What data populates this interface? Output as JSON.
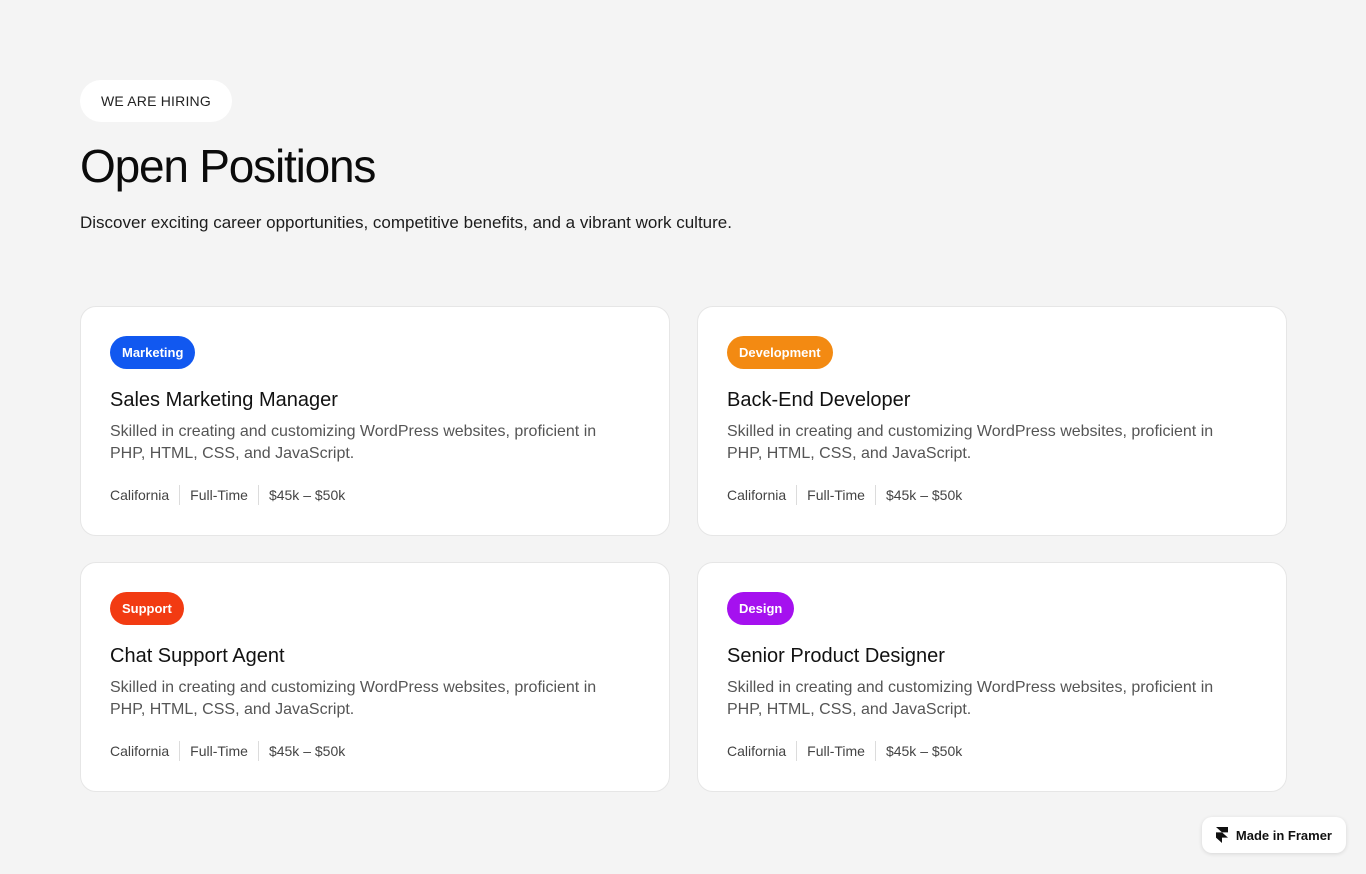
{
  "header": {
    "eyebrow": "WE ARE HIRING",
    "title": "Open Positions",
    "subtitle": "Discover exciting career opportunities, competitive benefits, and a vibrant work culture."
  },
  "jobs": [
    {
      "tag": "Marketing",
      "tag_color": "#1158f0",
      "title": "Sales Marketing Manager",
      "description": "Skilled in creating and customizing WordPress websites, proficient in PHP, HTML, CSS, and JavaScript.",
      "location": "California",
      "type": "Full-Time",
      "salary": "$45k – $50k"
    },
    {
      "tag": "Development",
      "tag_color": "#f38a12",
      "title": "Back-End Developer",
      "description": "Skilled in creating and customizing WordPress websites, proficient in PHP, HTML, CSS, and JavaScript.",
      "location": "California",
      "type": "Full-Time",
      "salary": "$45k – $50k"
    },
    {
      "tag": "Support",
      "tag_color": "#f23b12",
      "title": "Chat Support Agent",
      "description": "Skilled in creating and customizing WordPress websites, proficient in PHP, HTML, CSS, and JavaScript.",
      "location": "California",
      "type": "Full-Time",
      "salary": "$45k – $50k"
    },
    {
      "tag": "Design",
      "tag_color": "#a511ef",
      "title": "Senior Product Designer",
      "description": "Skilled in creating and customizing WordPress websites, proficient in PHP, HTML, CSS, and JavaScript.",
      "location": "California",
      "type": "Full-Time",
      "salary": "$45k – $50k"
    }
  ],
  "badge": {
    "label": "Made in Framer",
    "icon": "framer-logo-icon"
  }
}
